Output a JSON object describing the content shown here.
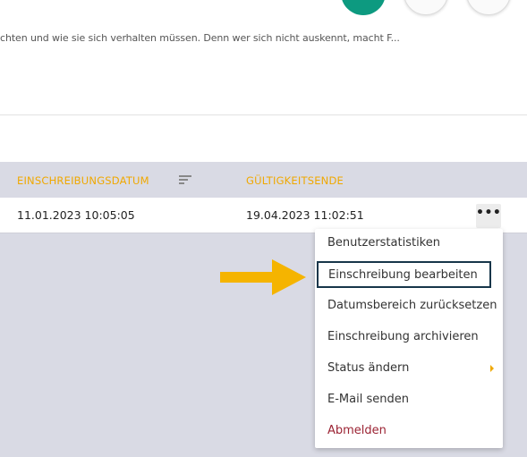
{
  "header": {
    "description": "chten und wie sie sich verhalten müssen. Denn wer sich nicht auskennt, macht F..."
  },
  "table": {
    "columns": [
      {
        "label": "EINSCHREIBUNGSDATUM",
        "sortable": true
      },
      {
        "label": "GÜLTIGKEITSENDE"
      }
    ],
    "rows": [
      {
        "enrollment_date": "11.01.2023 10:05:05",
        "valid_until": "19.04.2023 11:02:51",
        "actions_label": "•••"
      }
    ]
  },
  "context_menu": {
    "items": [
      {
        "label": "Benutzerstatistiken"
      },
      {
        "label": "Einschreibung bearbeiten",
        "highlighted": true
      },
      {
        "label": "Datumsbereich zurücksetzen"
      },
      {
        "label": "Einschreibung archivieren"
      },
      {
        "label": "Status ändern",
        "has_submenu": true
      },
      {
        "label": "E-Mail senden"
      },
      {
        "label": "Abmelden"
      }
    ]
  },
  "colors": {
    "accent": "#f0a800",
    "primary_button": "#0d9a80",
    "table_background": "#d9dae4",
    "highlight_border": "#17364a",
    "logout_text": "#9b2333"
  },
  "icons": [
    "sort-icon",
    "more-options-icon",
    "submenu-arrow-icon",
    "pointer-arrow-icon"
  ]
}
